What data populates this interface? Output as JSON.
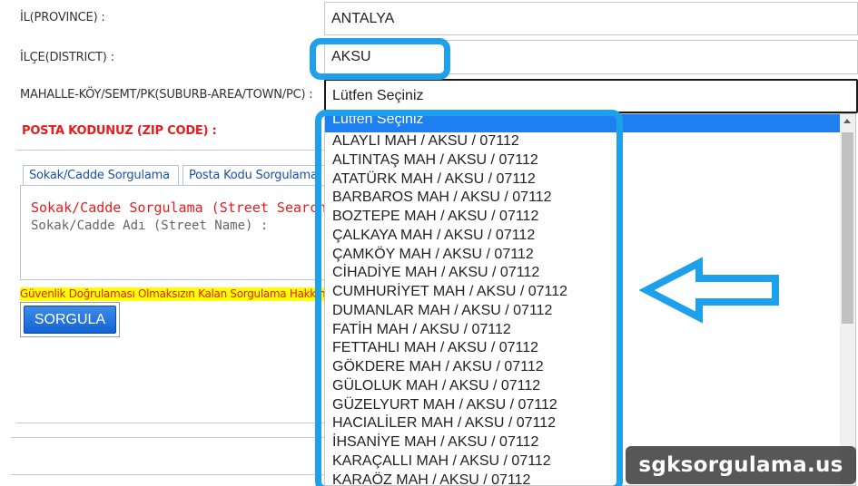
{
  "form": {
    "province_label": "İL(PROVINCE) :",
    "province_value": "ANTALYA",
    "district_label": "İLÇE(DISTRICT) :",
    "district_value": "AKSU",
    "suburb_label": "MAHALLE-KÖY/SEMT/PK(SUBURB-AREA/TOWN/PC) :",
    "suburb_value": "Lütfen Seçiniz",
    "zip_label": "POSTA KODUNUZ (ZIP CODE) :"
  },
  "tabs": [
    {
      "label": "Sokak/Cadde Sorgulama"
    },
    {
      "label": "Posta Kodu Sorgulama"
    }
  ],
  "panel": {
    "title": "Sokak/Cadde Sorgulama (Street Search)",
    "street_label": "Sokak/Cadde Adı (Street Name) :"
  },
  "warning": "Güvenlik Doğrulaması Olmaksızın Kalan Sorgulama Hakkınız",
  "submit_label": "SORGULA",
  "dropdown": {
    "selected_index": 0,
    "options": [
      "Lütfen Seçiniz",
      "ALAYLI MAH / AKSU / 07112",
      "ALTINTAŞ MAH / AKSU / 07112",
      "ATATÜRK MAH / AKSU / 07112",
      "BARBAROS MAH / AKSU / 07112",
      "BOZTEPE MAH / AKSU / 07112",
      "ÇALKAYA MAH / AKSU / 07112",
      "ÇAMKÖY MAH / AKSU / 07112",
      "CİHADİYE MAH / AKSU / 07112",
      "CUMHURİYET MAH / AKSU / 07112",
      "DUMANLAR MAH / AKSU / 07112",
      "FATİH MAH / AKSU / 07112",
      "FETTAHLI MAH / AKSU / 07112",
      "GÖKDERE MAH / AKSU / 07112",
      "GÜLOLUK MAH / AKSU / 07112",
      "GÜZELYURT MAH / AKSU / 07112",
      "HACIALİLER MAH / AKSU / 07112",
      "İHSANİYE MAH / AKSU / 07112",
      "KARAÇALLI MAH / AKSU / 07112",
      "KARAÖZ MAH / AKSU / 07112"
    ]
  },
  "watermark": "sgksorgulama.us",
  "colors": {
    "highlight": "#1da1ec",
    "selected_option": "#1e7ff0",
    "error_text": "#e81c1c",
    "warning_bg": "#ffff00",
    "button": "#1362d4"
  },
  "icons": {
    "arrow": "left-arrow-icon",
    "scroll_up": "scroll-up-arrow-icon"
  }
}
